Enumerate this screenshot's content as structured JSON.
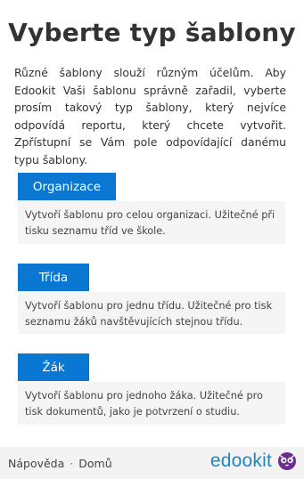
{
  "page": {
    "title": "Vyberte typ šablony",
    "intro": "Různé šablony slouží různým účelům. Aby Edookit Vaši šablonu správně zařadil, vyberte prosím takový typ šablony, který nejvíce odpovídá reportu, který chcete vytvořit. Zpřístupní se Vám pole odpovídající danému typu šablony."
  },
  "templates": [
    {
      "button_label": "Organizace",
      "description": "Vytvoří šablonu pro celou organizaci. Užitečné při tisku seznamu tříd ve škole."
    },
    {
      "button_label": "Třída",
      "description": "Vytvoří šablonu pro jednu třídu. Užitečné pro tisk seznamu žáků navštěvujících stejnou třídu."
    },
    {
      "button_label": "Žák",
      "description": "Vytvoří šablonu pro jednoho žáka. Užitečné pro tisk dokumentů, jako je potvrzení o studiu."
    }
  ],
  "footer": {
    "help_label": "Nápověda",
    "separator": "·",
    "home_label": "Domů",
    "brand_name": "edookit",
    "brand_icon": "edookit-owl-logo-icon",
    "brand_color": "#1b87c7",
    "icon_color": "#6b2d8f"
  },
  "colors": {
    "accent": "#0a78d2",
    "description_bg": "#f5f5f5"
  }
}
